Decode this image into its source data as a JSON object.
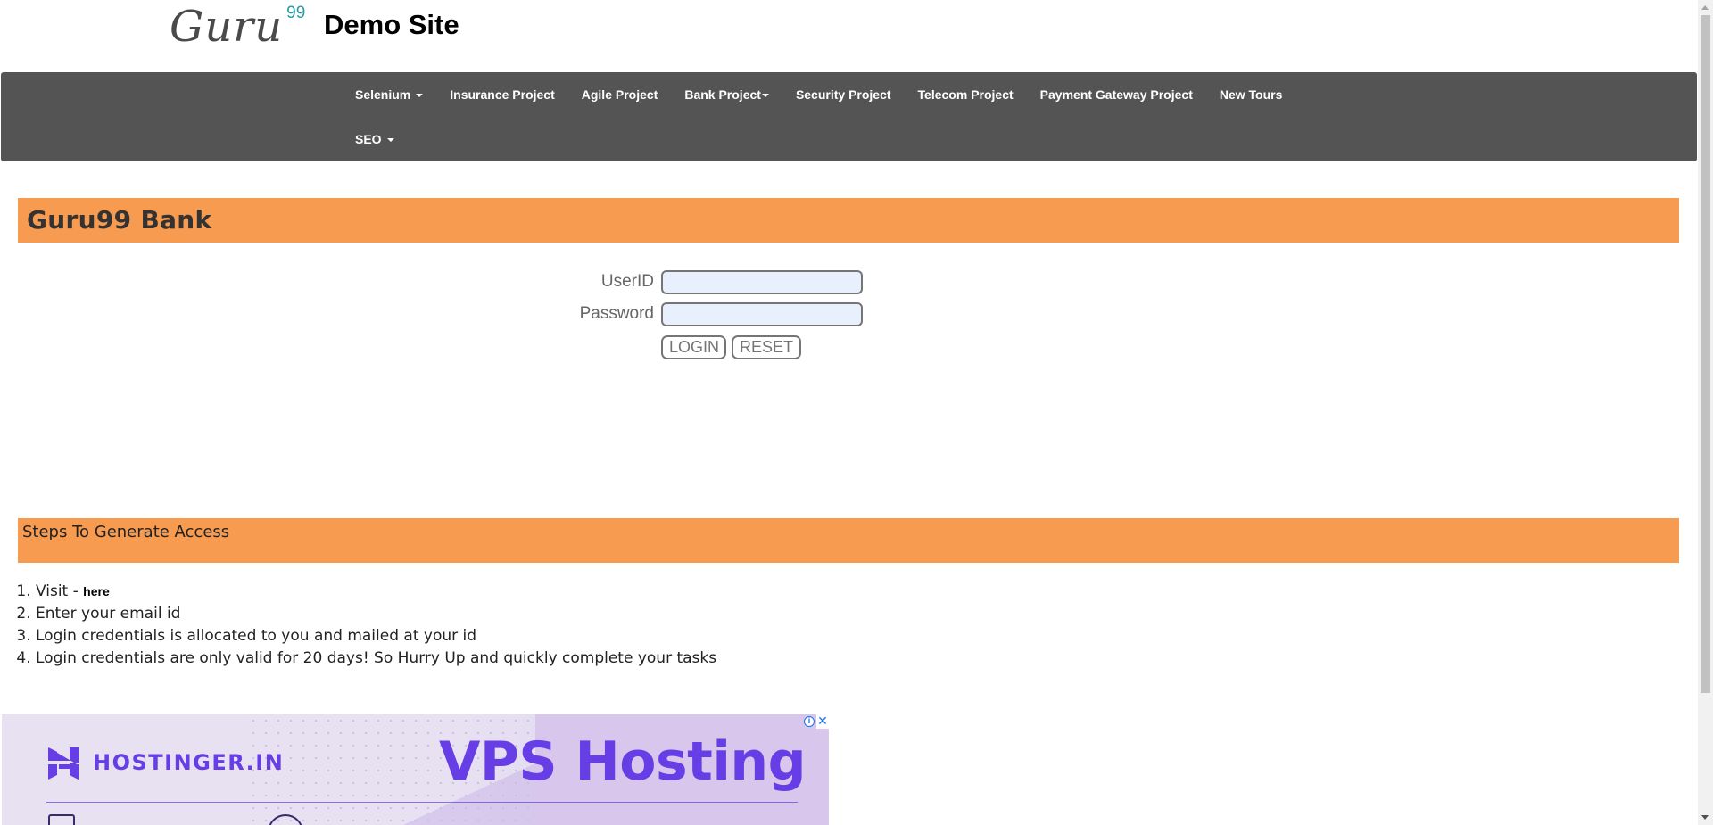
{
  "header": {
    "logo_text": "Guru",
    "logo_sup": "99",
    "site_title": "Demo Site"
  },
  "navbar": {
    "row1": [
      {
        "label": "Selenium",
        "dropdown": true
      },
      {
        "label": "Insurance Project",
        "dropdown": false
      },
      {
        "label": "Agile Project",
        "dropdown": false
      },
      {
        "label": "Bank Project",
        "dropdown": true
      },
      {
        "label": "Security Project",
        "dropdown": false
      },
      {
        "label": "Telecom Project",
        "dropdown": false
      },
      {
        "label": "Payment Gateway Project",
        "dropdown": false
      },
      {
        "label": "New Tours",
        "dropdown": false
      }
    ],
    "row2": [
      {
        "label": "SEO",
        "dropdown": true
      }
    ]
  },
  "bank": {
    "title": "Guru99 Bank"
  },
  "login_form": {
    "userid_label": "UserID",
    "userid_value": "",
    "password_label": "Password",
    "password_value": "",
    "login_button": "LOGIN",
    "reset_button": "RESET"
  },
  "steps": {
    "title": "Steps To Generate Access",
    "items": [
      {
        "prefix": "Visit - ",
        "link": "here"
      },
      {
        "text": "Enter your email id"
      },
      {
        "text": "Login credentials is allocated to you and mailed at your id"
      },
      {
        "text": "Login credentials are only valid for 20 days! So Hurry Up and quickly complete your tasks"
      }
    ]
  },
  "ad": {
    "brand": "HOSTINGER.IN",
    "headline": "VPS Hosting",
    "info_icon": "info-icon",
    "close_icon": "close-icon",
    "accent_color": "#673de6"
  },
  "colors": {
    "navbar_bg": "#545454",
    "section_bar": "#f79b51",
    "logo_sup": "#2b98a5"
  }
}
